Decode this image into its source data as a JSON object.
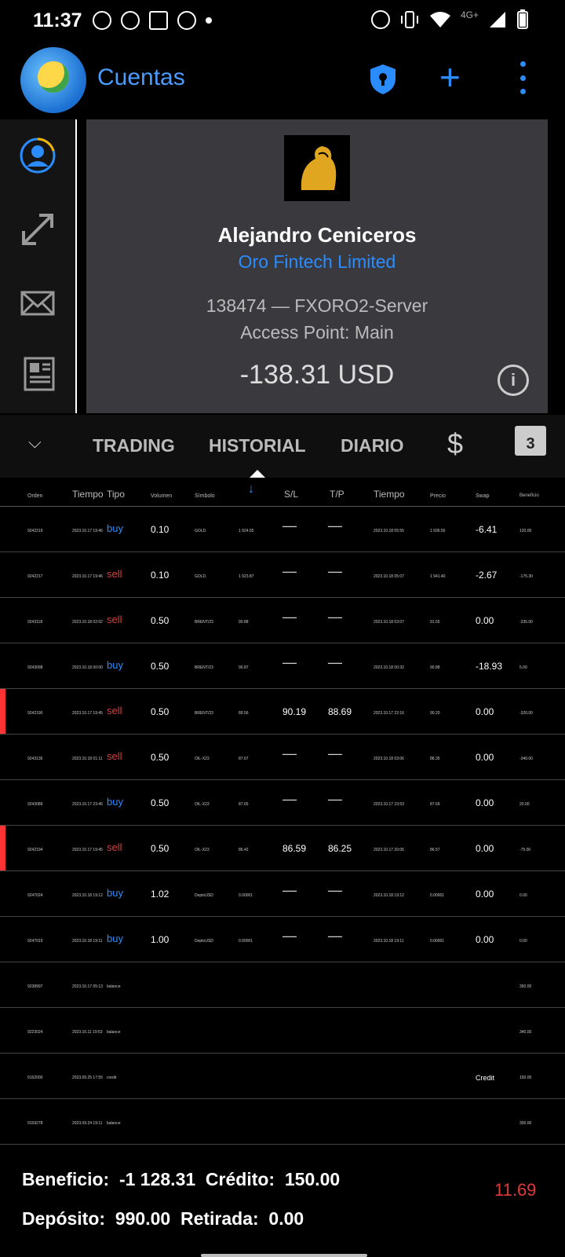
{
  "status_bar": {
    "time": "11:37",
    "network_label": "4G+",
    "left_icons": [
      "reddit-icon",
      "pinterest-icon",
      "app-icon",
      "chrome-icon",
      "dot-icon"
    ],
    "right_icons": [
      "alarm-icon",
      "vibrate-icon",
      "wifi-icon",
      "signal-icon",
      "battery-icon"
    ]
  },
  "app_bar": {
    "title": "Cuentas",
    "icons": [
      "shield-lock-icon",
      "plus-icon",
      "more-vert-icon"
    ],
    "accent": "#2a8cff"
  },
  "side_nav": {
    "items": [
      "user-icon",
      "arrows-icon",
      "mail-icon",
      "news-icon"
    ]
  },
  "account": {
    "name": "Alejandro Ceniceros",
    "company": "Oro Fintech Limited",
    "server": "138474 — FXORO2-Server",
    "access_point": "Access Point: Main",
    "balance": "-138.31 USD"
  },
  "tabs": {
    "items": [
      "TRADING",
      "HISTORIAL",
      "DIARIO"
    ],
    "active": "HISTORIAL",
    "calendar_day": "3"
  },
  "table": {
    "headers": {
      "orden": "Orden",
      "tiempo": "Tiempo",
      "tipo": "Tipo",
      "volumen": "Volumen",
      "simbolo": "Símbolo",
      "sl": "S/L",
      "tp": "T/P",
      "tiempo2": "Tiempo",
      "precio": "Precio",
      "swap": "Swap",
      "beneficio": "Beneficio"
    },
    "rows": [
      {
        "orden": "9242219",
        "tiempo": "2023.10.17 19:46",
        "tipo": "buy",
        "volumen": "0.10",
        "simbolo": "GOLD.",
        "precio_open": "1 924.55",
        "sl": "—",
        "tp": "—",
        "tiempo2": "2023.10.18 05:55",
        "precio": "1 936.55",
        "swap": "-6.41",
        "beneficio": "120.00"
      },
      {
        "orden": "9242217",
        "tiempo": "2023.10.17 19:46",
        "tipo": "sell",
        "volumen": "0.10",
        "simbolo": "GOLD.",
        "precio_open": "1 923.87",
        "sl": "—",
        "tp": "—",
        "tiempo2": "2023.10.18 05:07",
        "precio": "1 941.40",
        "swap": "-2.67",
        "beneficio": "-175.30"
      },
      {
        "orden": "9243118",
        "tiempo": "2023.10.18 02:02",
        "tipo": "sell",
        "volumen": "0.50",
        "simbolo": "BRENT/23",
        "precio_open": "90.88",
        "sl": "—",
        "tp": "—",
        "tiempo2": "2023.10.18 03:07",
        "precio": "91.55",
        "swap": "0.00",
        "beneficio": "-335.00"
      },
      {
        "orden": "9243098",
        "tiempo": "2023.10.18 00:00",
        "tipo": "buy",
        "volumen": "0.50",
        "simbolo": "BRENT/23",
        "precio_open": "90.87",
        "sl": "—",
        "tp": "—",
        "tiempo2": "2023.10.18 00:32",
        "precio": "90.88",
        "swap": "-18.93",
        "beneficio": "5.00"
      },
      {
        "orden": "9242190",
        "tiempo": "2023.10.17 19:45",
        "tipo": "sell",
        "volumen": "0.50",
        "simbolo": "BRENT/23",
        "precio_open": "89.56",
        "sl": "90.19",
        "tp": "88.69",
        "tiempo2": "2023.10.17 22:16",
        "precio": "90.20",
        "swap": "0.00",
        "beneficio": "-320.00",
        "highlight": true
      },
      {
        "orden": "9243136",
        "tiempo": "2023.10.18 01:11",
        "tipo": "sell",
        "volumen": "0.50",
        "simbolo": "OIL-X23",
        "precio_open": "87.67",
        "sl": "—",
        "tp": "—",
        "tiempo2": "2023.10.18 03:06",
        "precio": "88.35",
        "swap": "0.00",
        "beneficio": "-340.00"
      },
      {
        "orden": "9243089",
        "tiempo": "2023.10.17 23:46",
        "tipo": "buy",
        "volumen": "0.50",
        "simbolo": "OIL-X23",
        "precio_open": "87.65",
        "sl": "—",
        "tp": "—",
        "tiempo2": "2023.10.17 23:53",
        "precio": "87.69",
        "swap": "0.00",
        "beneficio": "20.00"
      },
      {
        "orden": "9242194",
        "tiempo": "2023.10.17 19:45",
        "tipo": "sell",
        "volumen": "0.50",
        "simbolo": "OIL-X23",
        "precio_open": "86.42",
        "sl": "86.59",
        "tp": "86.25",
        "tiempo2": "2023.10.17 20:06",
        "precio": "86.57",
        "swap": "0.00",
        "beneficio": "-75.00",
        "highlight": true
      },
      {
        "orden": "9247024",
        "tiempo": "2023.10.18 19:12",
        "tipo": "buy",
        "volumen": "1.02",
        "simbolo": "DeptoUSD",
        "precio_open": "0.00001",
        "sl": "—",
        "tp": "—",
        "tiempo2": "2023.10.18 19:12",
        "precio": "0.00001",
        "swap": "0.00",
        "beneficio": "0.00"
      },
      {
        "orden": "9247019",
        "tiempo": "2023.10.18 19:11",
        "tipo": "buy",
        "volumen": "1.00",
        "simbolo": "DeptoUSD",
        "precio_open": "0.00001",
        "sl": "—",
        "tp": "—",
        "tiempo2": "2023.10.18 19:11",
        "precio": "0.00001",
        "swap": "0.00",
        "beneficio": "0.00"
      },
      {
        "orden": "9238997",
        "tiempo": "2023.10.17 05:13",
        "tipo": "balance",
        "swap": "",
        "beneficio": "350.00"
      },
      {
        "orden": "9223024",
        "tiempo": "2023.10.11 19:53",
        "tipo": "balance",
        "swap": "",
        "beneficio": "340.00"
      },
      {
        "orden": "9162000",
        "tiempo": "2023.09.25 17:55",
        "tipo": "credit",
        "swap": "Credit",
        "beneficio": "150.00"
      },
      {
        "orden": "9159278",
        "tiempo": "2023.09.24 19:11",
        "tipo": "balance",
        "swap": "",
        "beneficio": "300.00"
      }
    ]
  },
  "summary": {
    "line1": "Beneficio:  -1 128.31  Crédito:  150.00",
    "line2": "Depósito:  990.00  Retirada:  0.00",
    "margin_level": "11.69"
  }
}
